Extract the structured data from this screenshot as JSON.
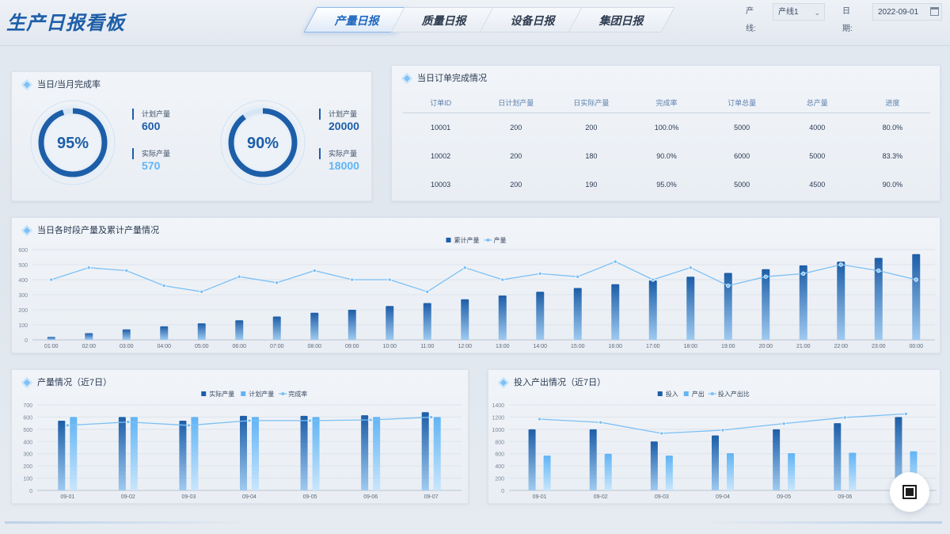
{
  "header": {
    "title": "生产日报看板",
    "tabs": [
      {
        "label": "产量日报",
        "active": true
      },
      {
        "label": "质量日报",
        "active": false
      },
      {
        "label": "设备日报",
        "active": false
      },
      {
        "label": "集团日报",
        "active": false
      }
    ],
    "filters": {
      "line_label": "产线:",
      "line_value": "产线1",
      "date_label": "日期:",
      "date_value": "2022-09-01"
    }
  },
  "completion": {
    "title": "当日/当月完成率",
    "day": {
      "percent_text": "95%",
      "percent": 0.95,
      "plan_label": "计划产量",
      "plan_value": "600",
      "actual_label": "实际产量",
      "actual_value": "570"
    },
    "month": {
      "percent_text": "90%",
      "percent": 0.9,
      "plan_label": "计划产量",
      "plan_value": "20000",
      "actual_label": "实际产量",
      "actual_value": "18000"
    }
  },
  "orders": {
    "title": "当日订单完成情况",
    "columns": [
      "订单ID",
      "日计划产量",
      "日实际产量",
      "完成率",
      "订单总量",
      "总产量",
      "进度"
    ],
    "rows": [
      [
        "10001",
        "200",
        "200",
        "100.0%",
        "5000",
        "4000",
        "80.0%"
      ],
      [
        "10002",
        "200",
        "180",
        "90.0%",
        "6000",
        "5000",
        "83.3%"
      ],
      [
        "10003",
        "200",
        "190",
        "95.0%",
        "5000",
        "4500",
        "90.0%"
      ]
    ]
  },
  "hourly": {
    "title": "当日各时段产量及累计产量情况",
    "legend": [
      "累计产量",
      "产量"
    ]
  },
  "weekly_output": {
    "title": "产量情况（近7日）",
    "legend": [
      "实际产量",
      "计划产量",
      "完成率"
    ]
  },
  "io": {
    "title": "投入产出情况（近7日）",
    "legend": [
      "投入",
      "产出",
      "投入产出比"
    ]
  },
  "colors": {
    "dark_blue": "#1d5ea8",
    "light_blue": "#61b4f5",
    "line": "#7cc0f5"
  },
  "chart_data": [
    {
      "type": "bar",
      "subtype": "bar+line",
      "categories": [
        "01:00",
        "02:00",
        "03:00",
        "04:00",
        "05:00",
        "06:00",
        "07:00",
        "08:00",
        "09:00",
        "10:00",
        "11:00",
        "12:00",
        "13:00",
        "14:00",
        "15:00",
        "16:00",
        "17:00",
        "18:00",
        "19:00",
        "20:00",
        "21:00",
        "22:00",
        "23:00",
        "00:00"
      ],
      "series": [
        {
          "name": "累计产量",
          "type": "bar",
          "values": [
            20,
            45,
            70,
            90,
            110,
            130,
            155,
            180,
            200,
            225,
            245,
            270,
            295,
            320,
            345,
            370,
            395,
            420,
            445,
            470,
            495,
            520,
            545,
            570
          ]
        },
        {
          "name": "产量",
          "type": "line",
          "values": [
            20,
            24,
            23,
            18,
            16,
            21,
            19,
            23,
            20,
            20,
            16,
            24,
            20,
            22,
            21,
            26,
            20,
            24,
            18,
            21,
            22,
            25,
            23,
            20
          ]
        }
      ],
      "yticks": [
        "0",
        "100",
        "200",
        "300",
        "400",
        "500",
        "600"
      ],
      "ylim": [
        0,
        600
      ],
      "legend_position": "top-center",
      "grid": true
    },
    {
      "type": "bar",
      "subtype": "bar+line",
      "categories": [
        "09-01",
        "09-02",
        "09-03",
        "09-04",
        "09-05",
        "09-06",
        "09-07"
      ],
      "series": [
        {
          "name": "实际产量",
          "type": "bar",
          "values": [
            570,
            600,
            570,
            610,
            610,
            615,
            640
          ]
        },
        {
          "name": "计划产量",
          "type": "bar",
          "values": [
            600,
            600,
            600,
            600,
            600,
            600,
            600
          ]
        },
        {
          "name": "完成率",
          "type": "line",
          "values": [
            0.95,
            1.0,
            0.95,
            1.02,
            1.02,
            1.03,
            1.07
          ]
        }
      ],
      "yticks": [
        "0",
        "100",
        "200",
        "300",
        "400",
        "500",
        "600",
        "700"
      ],
      "ylim": [
        0,
        700
      ],
      "legend_position": "top-center",
      "grid": true
    },
    {
      "type": "bar",
      "subtype": "bar+line",
      "categories": [
        "09-01",
        "09-02",
        "09-03",
        "09-04",
        "09-05",
        "09-06",
        "09-07"
      ],
      "series": [
        {
          "name": "投入",
          "type": "bar",
          "values": [
            1000,
            1000,
            800,
            900,
            1000,
            1100,
            1200
          ]
        },
        {
          "name": "产出",
          "type": "bar",
          "values": [
            570,
            600,
            570,
            610,
            610,
            615,
            640
          ]
        },
        {
          "name": "投入产出比",
          "type": "line",
          "values": [
            1.75,
            1.67,
            1.4,
            1.48,
            1.64,
            1.79,
            1.88
          ]
        }
      ],
      "yticks": [
        "0",
        "200",
        "400",
        "600",
        "800",
        "1000",
        "1200",
        "1400"
      ],
      "ylim": [
        0,
        1400
      ],
      "legend_position": "top-center",
      "grid": true
    }
  ]
}
